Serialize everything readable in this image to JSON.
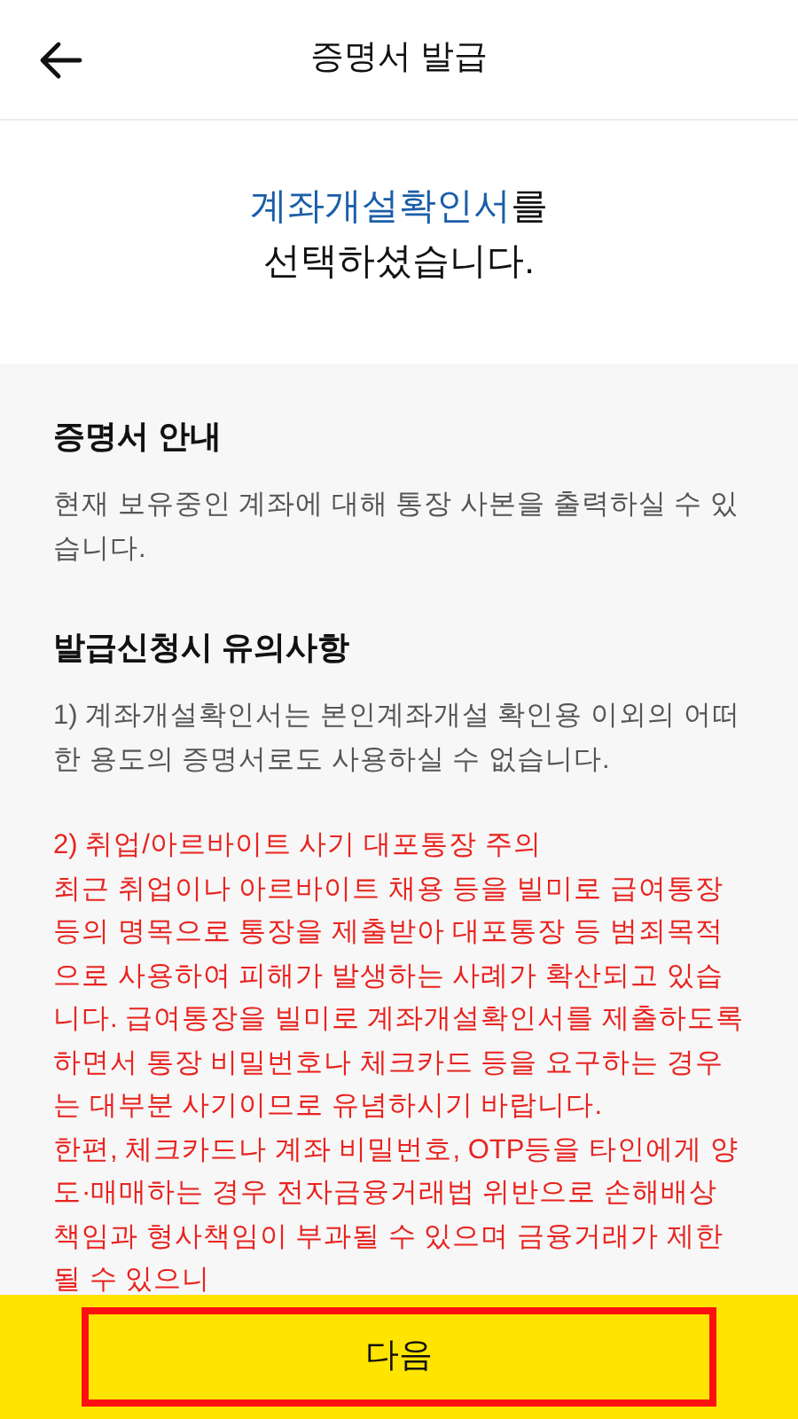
{
  "header": {
    "title": "증명서 발급"
  },
  "selection_message": {
    "highlight": "계좌개설확인서",
    "suffix": "를",
    "line_2": "선택하셨습니다."
  },
  "sections": [
    {
      "heading": "증명서 안내",
      "paragraphs": [
        {
          "kind": "normal",
          "text": "현재 보유중인 계좌에 대해 통장 사본을 출력하실 수 있습니다."
        }
      ]
    },
    {
      "heading": "발급신청시 유의사항",
      "paragraphs": [
        {
          "kind": "normal",
          "text": "1) 계좌개설확인서는 본인계좌개설 확인용 이외의 어떠한 용도의 증명서로도 사용하실 수 없습니다."
        },
        {
          "kind": "warning",
          "text": "2) 취업/아르바이트 사기 대포통장 주의"
        },
        {
          "kind": "warning_body",
          "text": "최근 취업이나 아르바이트 채용 등을 빌미로 급여통장 등의 명목으로 통장을 제출받아 대포통장 등 범죄목적으로 사용하여 피해가 발생하는 사례가 확산되고 있습니다. 급여통장을 빌미로 계좌개설확인서를 제출하도록 하면서 통장 비밀번호나 체크카드 등을 요구하는 경우는 대부분 사기이므로 유념하시기 바랍니다."
        },
        {
          "kind": "warning_body",
          "text": "한편, 체크카드나 계좌 비밀번호, OTP등을 타인에게 양도·매매하는 경우 전자금융거래법 위반으로 손해배상책임과 형사책임이 부과될 수 있으며 금융거래가 제한될 수 있으니"
        }
      ]
    }
  ],
  "next_button": {
    "label": "다음",
    "highlighted": true
  }
}
